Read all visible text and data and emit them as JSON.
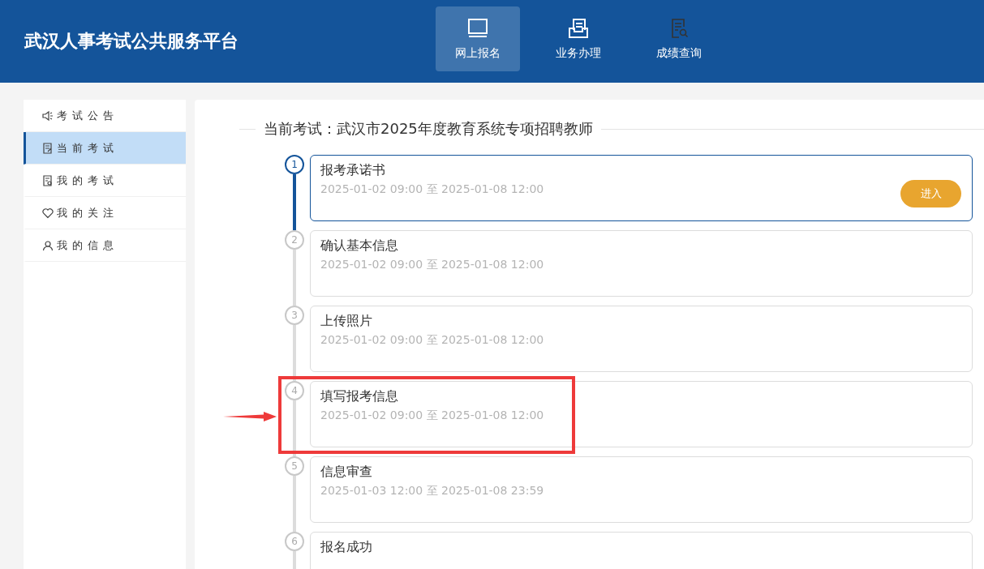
{
  "header": {
    "title": "武汉人事考试公共服务平台",
    "nav": [
      {
        "label": "网上报名",
        "kind": "monitor",
        "selected": true
      },
      {
        "label": "业务办理",
        "kind": "tray",
        "selected": false
      },
      {
        "label": "成绩查询",
        "kind": "search-doc",
        "selected": false
      }
    ]
  },
  "sidebar": {
    "items": [
      {
        "label": "考试公告",
        "kind": "speaker",
        "selected": false
      },
      {
        "label": "当前考试",
        "kind": "doc",
        "selected": true
      },
      {
        "label": "我的考试",
        "kind": "doc-person",
        "selected": false
      },
      {
        "label": "我的关注",
        "kind": "heart",
        "selected": false
      },
      {
        "label": "我的信息",
        "kind": "person",
        "selected": false
      }
    ]
  },
  "exam": {
    "heading": "当前考试：武汉市2025年度教育系统专项招聘教师",
    "steps": [
      {
        "number": "1",
        "title": "报考承诺书",
        "time": "2025-01-02 09:00 至 2025-01-08 12:00",
        "selected": true,
        "button": "进入"
      },
      {
        "number": "2",
        "title": "确认基本信息",
        "time": "2025-01-02 09:00 至 2025-01-08 12:00",
        "selected": false
      },
      {
        "number": "3",
        "title": "上传照片",
        "time": "2025-01-02 09:00 至 2025-01-08 12:00",
        "selected": false
      },
      {
        "number": "4",
        "title": "填写报考信息",
        "time": "2025-01-02 09:00 至 2025-01-08 12:00",
        "selected": false,
        "highlighted": true
      },
      {
        "number": "5",
        "title": "信息审查",
        "time": "2025-01-03 12:00 至 2025-01-08 23:59",
        "selected": false
      },
      {
        "number": "6",
        "title": "报名成功",
        "selected": false
      }
    ]
  }
}
